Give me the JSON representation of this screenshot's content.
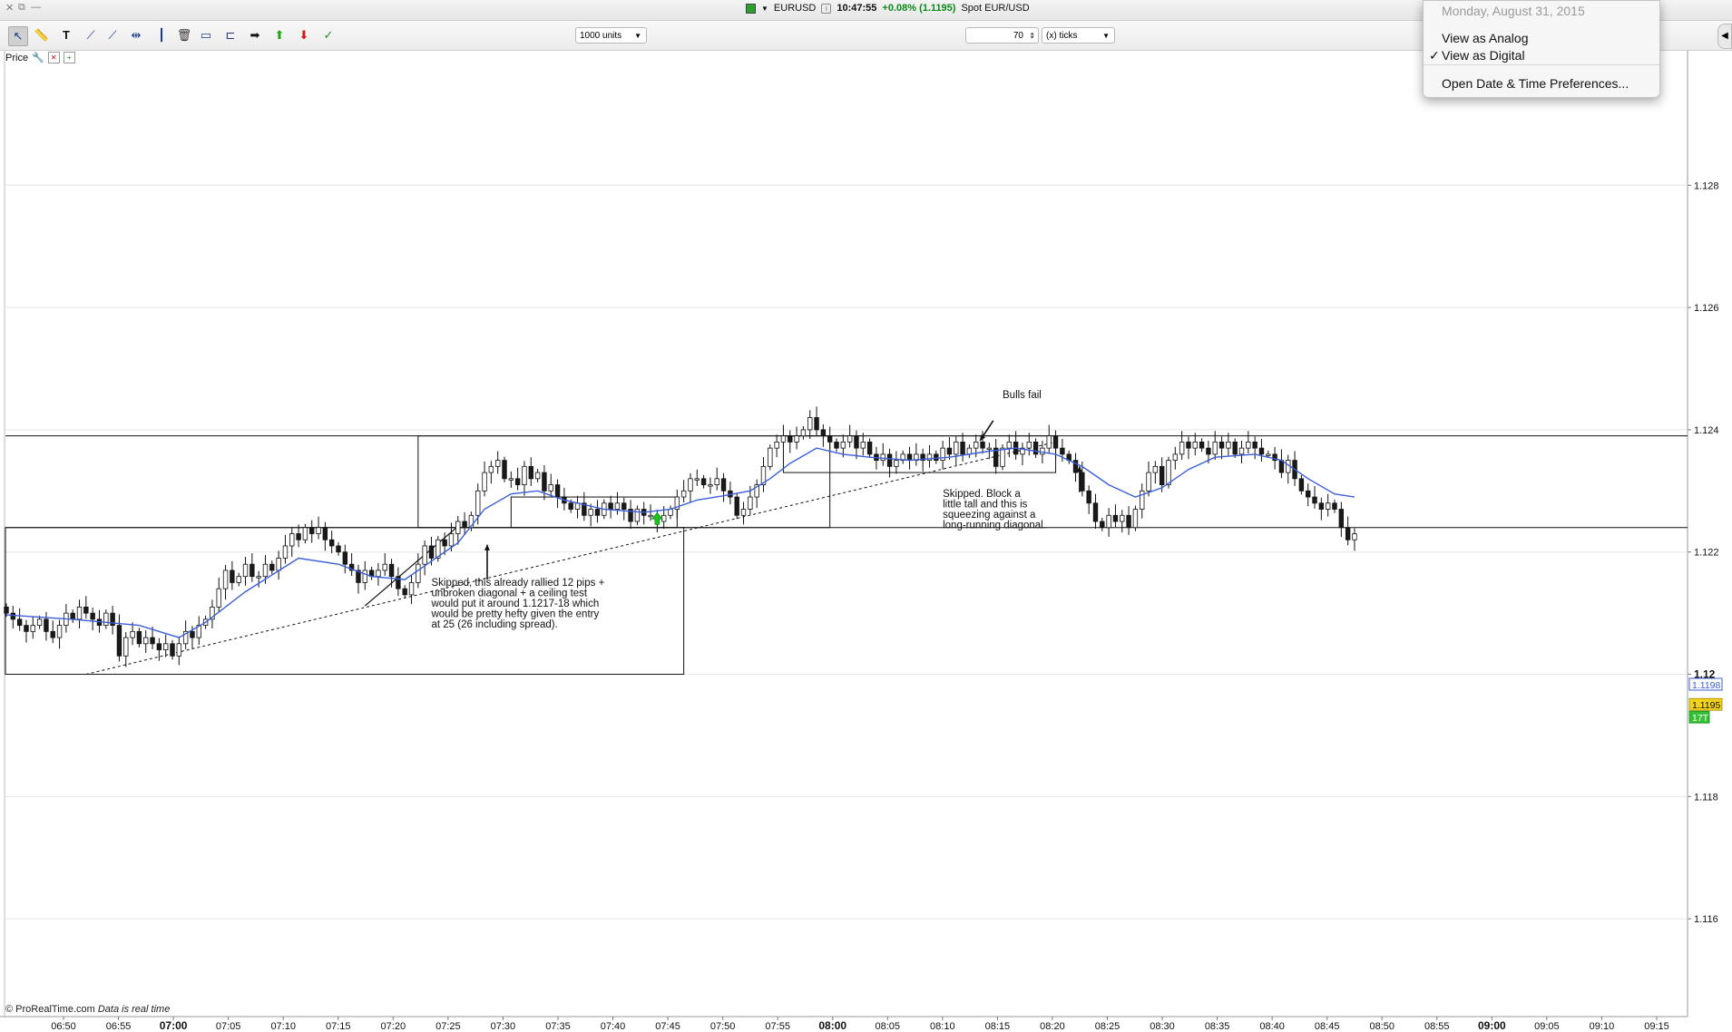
{
  "window": {
    "controls": [
      "✕",
      "⧉",
      "—"
    ],
    "symbol": "EURUSD",
    "time": "10:47:55",
    "change": "+0.08% (1.1195)",
    "instrument": "Spot EUR/USD"
  },
  "toolbar": {
    "units_select": "1000 units",
    "ticks_value": "70",
    "ticks_select": "(x) ticks",
    "icons": [
      "cursor-icon",
      "ruler-icon",
      "text-icon",
      "line-icon",
      "ray-icon",
      "horizontal-line-icon",
      "vertical-line-icon",
      "trash-icon",
      "rectangle-icon",
      "channel-icon",
      "arrow-right-icon",
      "arrow-up-icon",
      "arrow-down-icon",
      "indicator-icon"
    ]
  },
  "panel": {
    "price_label": "Price"
  },
  "menu": {
    "header": "Monday, August 31, 2015",
    "items": [
      "View as Analog",
      "View as Digital",
      "Open Date & Time Preferences..."
    ],
    "checked_index": 1
  },
  "footer": {
    "copyright": "© ProRealTime.com",
    "realtime": "Data is real time"
  },
  "colors": {
    "ma": "#3a5fd8",
    "bull": "#ffffff",
    "bear": "#1a1a1a",
    "last_price_bg": "#f2d21b",
    "ticks_badge_bg": "#35c035"
  },
  "chart_data": {
    "type": "candlestick",
    "instrument": "EUR/USD",
    "timeframe": "70 ticks",
    "ylim": [
      1.1144,
      1.1302
    ],
    "y_ticks": [
      "1.128",
      "1.126",
      "1.124",
      "1.122",
      "1.12",
      "1.118",
      "1.116"
    ],
    "x_tick_labels": [
      "06:50",
      "06:55",
      "07:00",
      "07:05",
      "07:10",
      "07:15",
      "07:20",
      "07:25",
      "07:30",
      "07:35",
      "07:40",
      "07:45",
      "07:50",
      "07:55",
      "08:00",
      "08:05",
      "08:10",
      "08:15",
      "08:20",
      "08:25",
      "08:30",
      "08:35",
      "08:40",
      "08:45",
      "08:50",
      "08:55",
      "09:00",
      "09:05",
      "09:10",
      "09:15"
    ],
    "x_tick_bold": [
      "07:00",
      "08:00",
      "09:00"
    ],
    "price_labels": {
      "ma_value": "1.1198",
      "last_price": "1.1195",
      "ticks_remaining": "17T"
    },
    "close": [
      1.121,
      1.1209,
      1.1208,
      1.1207,
      1.1208,
      1.1209,
      1.1207,
      1.1206,
      1.1208,
      1.121,
      1.1209,
      1.1211,
      1.121,
      1.1209,
      1.1208,
      1.121,
      1.1208,
      1.1203,
      1.1206,
      1.1207,
      1.1205,
      1.1206,
      1.1205,
      1.1204,
      1.1205,
      1.1203,
      1.1205,
      1.1207,
      1.1206,
      1.1208,
      1.1209,
      1.1211,
      1.1214,
      1.1217,
      1.1215,
      1.1216,
      1.1218,
      1.1216,
      1.1216,
      1.1218,
      1.1217,
      1.1219,
      1.1221,
      1.1223,
      1.1222,
      1.1224,
      1.1223,
      1.1224,
      1.1222,
      1.1221,
      1.122,
      1.1218,
      1.1217,
      1.1215,
      1.1217,
      1.1216,
      1.1217,
      1.1218,
      1.1216,
      1.1214,
      1.1213,
      1.1215,
      1.1218,
      1.1221,
      1.1219,
      1.1222,
      1.1221,
      1.1223,
      1.1225,
      1.1224,
      1.1226,
      1.123,
      1.1233,
      1.1234,
      1.1235,
      1.1232,
      1.1232,
      1.1231,
      1.1234,
      1.1232,
      1.1233,
      1.123,
      1.1231,
      1.1229,
      1.1228,
      1.1227,
      1.1228,
      1.1226,
      1.1227,
      1.1226,
      1.1228,
      1.1227,
      1.1228,
      1.1227,
      1.1225,
      1.1227,
      1.1226,
      1.1226,
      1.1225,
      1.1226,
      1.1227,
      1.1229,
      1.123,
      1.1232,
      1.1232,
      1.1231,
      1.1231,
      1.1232,
      1.123,
      1.1229,
      1.1226,
      1.1227,
      1.1229,
      1.1231,
      1.1234,
      1.1237,
      1.1238,
      1.1239,
      1.1238,
      1.1239,
      1.124,
      1.1242,
      1.124,
      1.1239,
      1.1238,
      1.1237,
      1.1238,
      1.1239,
      1.1237,
      1.1238,
      1.1236,
      1.1235,
      1.1236,
      1.1234,
      1.1235,
      1.1236,
      1.1235,
      1.1236,
      1.1235,
      1.1236,
      1.1235,
      1.1237,
      1.1236,
      1.1238,
      1.1236,
      1.1237,
      1.1238,
      1.1237,
      1.1237,
      1.1234,
      1.1237,
      1.1238,
      1.1236,
      1.1237,
      1.1238,
      1.1236,
      1.1237,
      1.1239,
      1.1237,
      1.1236,
      1.1235,
      1.1233,
      1.123,
      1.1228,
      1.1225,
      1.1224,
      1.1226,
      1.1225,
      1.1226,
      1.1224,
      1.1227,
      1.123,
      1.1233,
      1.1234,
      1.1231,
      1.1235,
      1.1236,
      1.1238,
      1.1237,
      1.1238,
      1.1237,
      1.1236,
      1.1238,
      1.1237,
      1.1238,
      1.1236,
      1.1237,
      1.1238,
      1.1237,
      1.1236,
      1.1236,
      1.1235,
      1.1233,
      1.1235,
      1.1232,
      1.123,
      1.1229,
      1.1228,
      1.1227,
      1.1228,
      1.1227,
      1.1224,
      1.1222,
      1.1223
    ],
    "ma_points": [
      [
        0,
        1.12097
      ],
      [
        10,
        1.1209
      ],
      [
        20,
        1.1208
      ],
      [
        26,
        1.1206
      ],
      [
        30,
        1.12085
      ],
      [
        36,
        1.12135
      ],
      [
        44,
        1.1219
      ],
      [
        50,
        1.1218
      ],
      [
        55,
        1.1216
      ],
      [
        60,
        1.12155
      ],
      [
        64,
        1.12185
      ],
      [
        68,
        1.12215
      ],
      [
        72,
        1.1227
      ],
      [
        76,
        1.12295
      ],
      [
        80,
        1.123
      ],
      [
        84,
        1.12285
      ],
      [
        90,
        1.1227
      ],
      [
        96,
        1.12265
      ],
      [
        100,
        1.1227
      ],
      [
        104,
        1.12285
      ],
      [
        108,
        1.12292
      ],
      [
        112,
        1.123
      ],
      [
        115,
        1.1232
      ],
      [
        118,
        1.12345
      ],
      [
        122,
        1.1237
      ],
      [
        126,
        1.1236
      ],
      [
        130,
        1.12355
      ],
      [
        136,
        1.1235
      ],
      [
        142,
        1.12355
      ],
      [
        148,
        1.12365
      ],
      [
        152,
        1.1237
      ],
      [
        158,
        1.1236
      ],
      [
        162,
        1.1234
      ],
      [
        166,
        1.1231
      ],
      [
        170,
        1.1229
      ],
      [
        174,
        1.12305
      ],
      [
        178,
        1.12335
      ],
      [
        182,
        1.12355
      ],
      [
        188,
        1.1236
      ],
      [
        192,
        1.1235
      ],
      [
        196,
        1.1232
      ],
      [
        200,
        1.12295
      ],
      [
        203,
        1.1229
      ]
    ],
    "boxes": [
      {
        "x0": -1,
        "x1": 102,
        "y0": 1.12,
        "y1": 1.1224
      },
      {
        "x0": 62,
        "x1": 124,
        "y0": 1.1224,
        "y1": 1.1239
      },
      {
        "x0": 76,
        "x1": 101,
        "y0": 1.1224,
        "y1": 1.1229
      },
      {
        "x0": 117,
        "x1": 158,
        "y0": 1.1233,
        "y1": 1.1239
      }
    ],
    "hlines": [
      1.1224,
      1.1239
    ],
    "dotted_trend": {
      "x0": 12,
      "y0": 1.12,
      "x1": 158,
      "y1": 1.1238
    },
    "solid_trend": {
      "x0": 54,
      "y0": 1.12112,
      "x1": 68,
      "y1": 1.12242
    },
    "signal_marker": {
      "index": 98,
      "price": 1.12254
    },
    "annotations": [
      {
        "lines": [
          "Bulls fail"
        ],
        "x": 150,
        "y": 1.12452
      },
      {
        "lines": [
          "Skipped, this already rallied 12 pips +",
          "unbroken diagonal + a ceiling test",
          "would put it around 1.1217-18 which",
          "would be pretty hefty given the entry",
          "at 25 (26 including spread)."
        ],
        "x": 64,
        "y": 1.12145
      },
      {
        "lines": [
          "Skipped.  Block a",
          "little tall and this is",
          "squeezing against a",
          "long-running diagonal."
        ],
        "x": 141,
        "y": 1.1229
      }
    ]
  }
}
